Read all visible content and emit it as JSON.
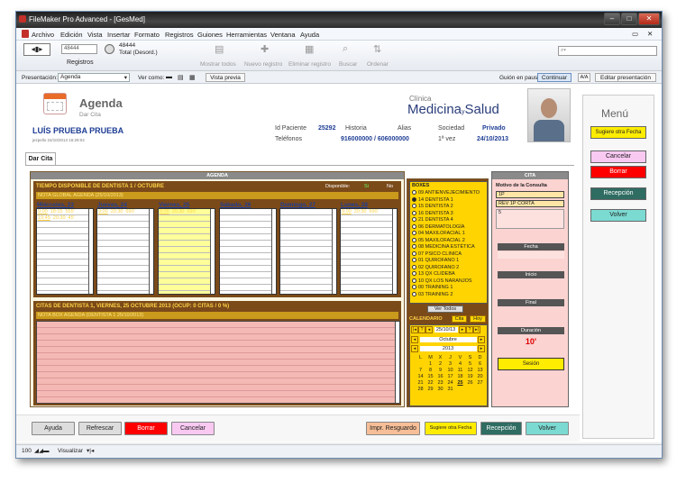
{
  "window": {
    "title": "FileMaker Pro Advanced - [GesMed]"
  },
  "menu": [
    "Archivo",
    "Edición",
    "Vista",
    "Insertar",
    "Formato",
    "Registros",
    "Guiones",
    "Herramientas",
    "Ventana",
    "Ayuda"
  ],
  "toolbar": {
    "record_current": "48444",
    "record_total": "48444",
    "total_label": "Total (Desord.)",
    "registros_label": "Registros",
    "show_all": "Mostrar todos",
    "new_record": "Nuevo registro",
    "delete_record": "Eliminar registro",
    "search": "Buscar",
    "sort": "Ordenar"
  },
  "status": {
    "layout_label": "Presentación:",
    "layout_value": "Agenda",
    "view_label": "Ver como:",
    "preview": "Vista previa",
    "script_paused": "Guión en pausa",
    "continue": "Continuar",
    "aa": "A/A",
    "edit_layout": "Editar presentación"
  },
  "header": {
    "title": "Agenda",
    "subtitle": "Dar Cita",
    "clinic_top": "Clínica",
    "clinic_name_1": "Medicina",
    "clinic_y": "y",
    "clinic_name_2": "Salud",
    "patient_name": "LUÍS PRUEBA PRUEBA",
    "id_label": "Id Paciente",
    "id_value": "25292",
    "history_label": "Historia",
    "history_value": "",
    "alias_label": "Alias",
    "alias_value": "",
    "society_label": "Sociedad",
    "society_value": "Privado",
    "phones_label": "Teléfonos",
    "phones_value": "916000000 / 606000000",
    "first_label": "1ª vez",
    "first_value": "24/10/2013",
    "meta": "jezpello 24/10/2013 16:29:04"
  },
  "tab": "Dar Cita",
  "agenda": {
    "title": "AGENDA",
    "time_available": "TIEMPO DISPONIBLE DE DENTISTA 1 / OCTUBRE",
    "available_label": "Disponible:",
    "yes": "Si",
    "no": "No",
    "global_note": "NOTA GLOBAL AGENDA (25/10/2013)",
    "days": [
      {
        "name": "Miércoles, 23",
        "slots": [
          [
            "9:00",
            "18:15",
            "555'"
          ],
          [
            "19:45",
            "20:30",
            "45'"
          ]
        ]
      },
      {
        "name": "Jueves, 24",
        "slots": [
          [
            "9:00",
            "20:30",
            "690'"
          ]
        ]
      },
      {
        "name": "Viernes, 25",
        "slots": [
          [
            "9:00",
            "20:30",
            "690'"
          ]
        ]
      },
      {
        "name": "Sábado, 26",
        "slots": []
      },
      {
        "name": "Domingo, 27",
        "slots": []
      },
      {
        "name": "Lunes, 28",
        "slots": [
          [
            "9:00",
            "20:30",
            "690'"
          ]
        ]
      }
    ],
    "citas_title": "CITAS DE DENTISTA 1,  VIERNES, 25 OCTUBRE 2013 (OCUP: 0 CITAS / 0 %)",
    "citas_note": "NOTA BOX AGENDA (DENTISTA 1 25/10/2013)"
  },
  "boxes": {
    "title": "BOXES",
    "items": [
      "09 ANTIENVEJECIMIENTO",
      "14 DENTISTA 1",
      "15 DENTISTA 2",
      "16 DENTISTA 3",
      "21 DENTISTA 4",
      "06 DERMATOLOGÍA",
      "04 MAXILOFACIAL 1",
      "05 MAXILOFACIAL 2",
      "08 MEDICINA ESTÉTICA",
      "07 PSICO CLINICA",
      "01 QUIROFANO 1",
      "02 QUIROFANO 2",
      "13 QX CLIDEBA",
      "10 QX LOS NARANJOS",
      "00 TRAINING 1",
      "03 TRAINING 2"
    ],
    "selected": 1,
    "ver_todos": "Ver Todos"
  },
  "calendar": {
    "title": "CALENDARIO",
    "cita": "Cita",
    "hoy": "Hoy",
    "date": "25/10/13",
    "month": "Octubre",
    "year": "2013",
    "weekdays": [
      "L",
      "M",
      "X",
      "J",
      "V",
      "S",
      "D"
    ],
    "weeks": [
      [
        "",
        "1",
        "2",
        "3",
        "4",
        "5",
        "6"
      ],
      [
        "7",
        "8",
        "9",
        "10",
        "11",
        "12",
        "13"
      ],
      [
        "14",
        "15",
        "16",
        "17",
        "18",
        "19",
        "20"
      ],
      [
        "21",
        "22",
        "23",
        "24",
        "25",
        "26",
        "27"
      ],
      [
        "28",
        "29",
        "30",
        "31",
        "",
        "",
        ""
      ]
    ]
  },
  "cita": {
    "title": "CITA",
    "motivo_label": "Motivo de la Consulta",
    "motivo_1": "1P",
    "motivo_2": "REV 1P CORTA",
    "motivo_3": "5",
    "fecha": "Fecha",
    "inicio": "Inicio",
    "final": "Final",
    "duracion": "Duración",
    "duracion_value": "10'",
    "sesion": "Sesión"
  },
  "menu_panel": {
    "title": "Menú",
    "sugiere": "Sugiere otra Fecha",
    "cancelar": "Cancelar",
    "borrar": "Borrar",
    "recepcion": "Recepción",
    "volver": "Volver"
  },
  "bottom": {
    "ayuda": "Ayuda",
    "refrescar": "Refrescar",
    "borrar": "Borrar",
    "cancelar": "Cancelar",
    "impr": "Impr. Resguardo",
    "sugiere": "Sugiere otra Fecha",
    "recepcion": "Recepción",
    "volver": "Volver"
  },
  "footer": {
    "zoom": "100",
    "mode": "Visualizar"
  }
}
